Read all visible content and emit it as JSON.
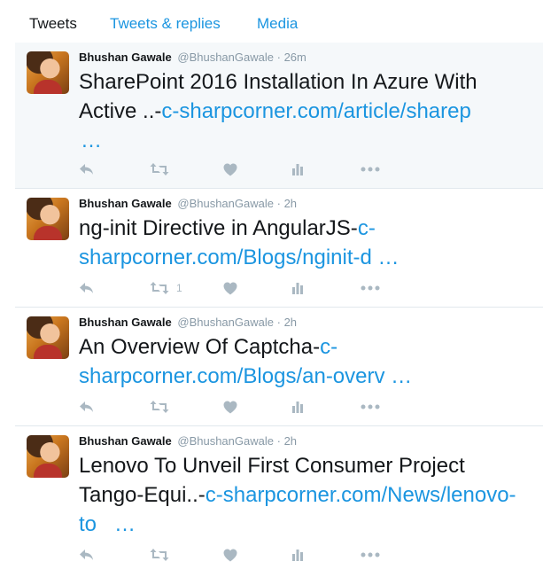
{
  "tabs": [
    {
      "label": "Tweets",
      "active": true
    },
    {
      "label": "Tweets & replies",
      "active": false
    },
    {
      "label": "Media",
      "active": false
    }
  ],
  "icons": {
    "reply": "reply-icon",
    "retweet": "retweet-icon",
    "like": "heart-icon",
    "analytics": "analytics-icon",
    "more": "more-icon"
  },
  "colors": {
    "link": "#1b95e0",
    "muted": "#8899a6",
    "icon": "#aab8c2",
    "highlight_bg": "#f5f8fa"
  },
  "tweets": [
    {
      "name": "Bhushan Gawale",
      "handle": "@BhushanGawale",
      "sep": "·",
      "time": "26m",
      "text": "SharePoint 2016 Installation In Azure With Active ..-",
      "link": "c-sharpcorner.com/article/sharep",
      "ellipsis": "…",
      "retweets": ""
    },
    {
      "name": "Bhushan Gawale",
      "handle": "@BhushanGawale",
      "sep": "·",
      "time": "2h",
      "text": "ng-init Directive in AngularJS-",
      "link": "c-sharpcorner.com/Blogs/nginit-d",
      "ellipsis": "…",
      "retweets": "1"
    },
    {
      "name": "Bhushan Gawale",
      "handle": "@BhushanGawale",
      "sep": "·",
      "time": "2h",
      "text": "An Overview Of Captcha-",
      "link": "c-sharpcorner.com/Blogs/an-overv",
      "ellipsis": "…",
      "retweets": ""
    },
    {
      "name": "Bhushan Gawale",
      "handle": "@BhushanGawale",
      "sep": "·",
      "time": "2h",
      "text": "Lenovo To Unveil First Consumer Project Tango-Equi..-",
      "link": "c-sharpcorner.com/News/lenovo-to",
      "ellipsis": "…",
      "retweets": ""
    }
  ]
}
